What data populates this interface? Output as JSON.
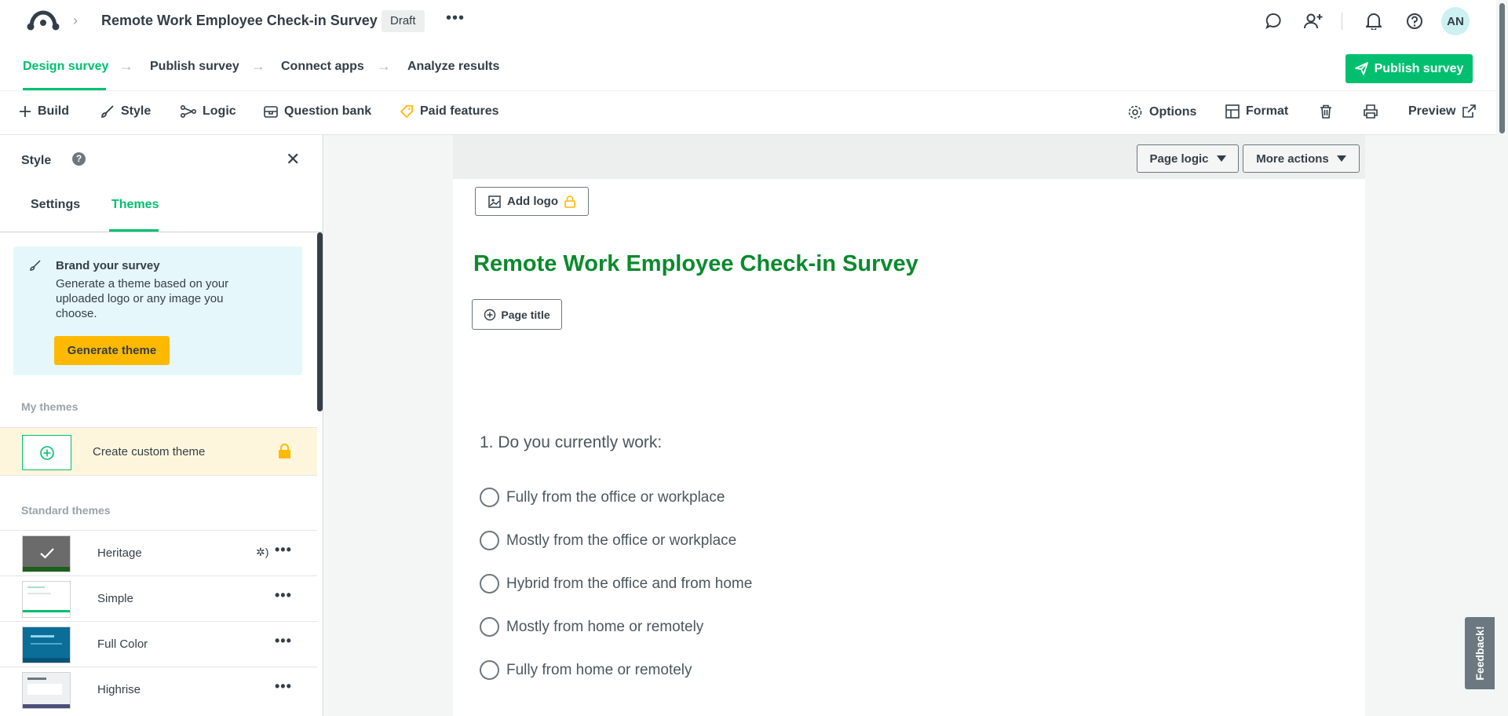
{
  "header": {
    "survey_title": "Remote Work Employee Check-in Survey",
    "status_badge": "Draft",
    "more_glyph": "•••",
    "avatar_initials": "AN"
  },
  "steps": [
    {
      "label": "Design survey",
      "active": true
    },
    {
      "label": "Publish survey",
      "active": false
    },
    {
      "label": "Connect apps",
      "active": false
    },
    {
      "label": "Analyze results",
      "active": false
    }
  ],
  "publish_button": "Publish survey",
  "toolbar": {
    "build": "Build",
    "style": "Style",
    "logic": "Logic",
    "question_bank": "Question bank",
    "paid_features": "Paid features",
    "options": "Options",
    "format": "Format",
    "preview": "Preview"
  },
  "sidebar": {
    "title": "Style",
    "help": "?",
    "tabs": [
      "Settings",
      "Themes"
    ],
    "active_tab": "Themes",
    "brand_card": {
      "title": "Brand your survey",
      "description": "Generate a theme based on your uploaded logo or any image you choose.",
      "button": "Generate theme"
    },
    "my_themes_label": "My themes",
    "custom_theme_label": "Create custom theme",
    "standard_themes_label": "Standard themes",
    "themes": [
      {
        "name": "Heritage",
        "selected": true
      },
      {
        "name": "Simple",
        "selected": false
      },
      {
        "name": "Full Color",
        "selected": false
      },
      {
        "name": "Highrise",
        "selected": false
      }
    ],
    "theme_menu_glyph": "•••"
  },
  "canvas": {
    "page_logic": "Page logic",
    "more_actions": "More actions",
    "add_logo": "Add logo",
    "survey_heading": "Remote Work Employee Check-in Survey",
    "page_title_button": "Page title",
    "question": "1. Do you currently work:",
    "options": [
      "Fully from the office or workplace",
      "Mostly from the office or workplace",
      "Hybrid from the office and from home",
      "Mostly from home or remotely",
      "Fully from home or remotely"
    ]
  },
  "feedback_tab": "Feedback!",
  "colors": {
    "accent": "#00bf6f",
    "heading_green": "#0a8a2d",
    "warning_yellow": "#ffb900",
    "brand_card_bg": "#e5f7fa",
    "text": "#333e48"
  }
}
